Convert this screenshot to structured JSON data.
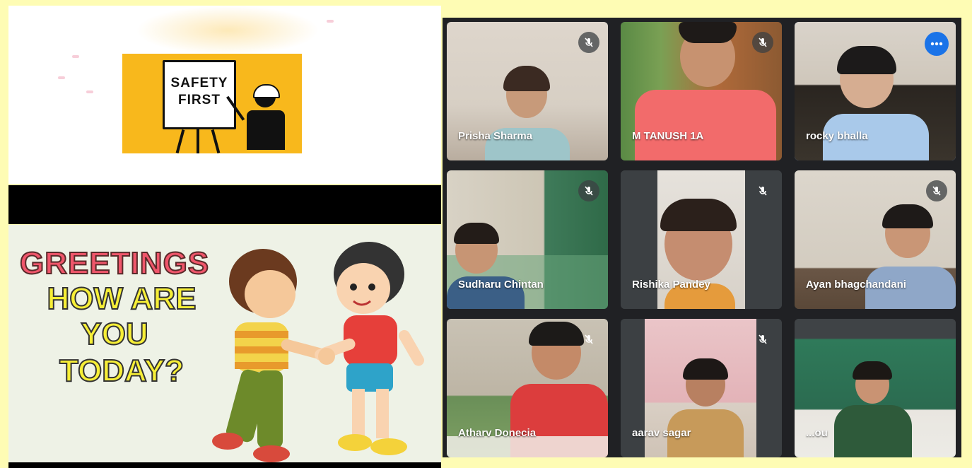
{
  "slides": {
    "safety_sign": {
      "line1": "SAFETY",
      "line2": "FIRST"
    },
    "greeting": {
      "line1": "GREETINGS",
      "line2": "HOW ARE",
      "line3": "YOU",
      "line4": "TODAY?"
    }
  },
  "meet": {
    "participants": [
      {
        "name": "Prisha Sharma",
        "muted": true
      },
      {
        "name": "M TANUSH 1A",
        "muted": true
      },
      {
        "name": "rocky bhalla",
        "muted": false,
        "active_speaker": true
      },
      {
        "name": "Sudharu Chintan",
        "muted": true
      },
      {
        "name": "Rishika Pandey",
        "muted": true
      },
      {
        "name": "Ayan bhagchandani",
        "muted": true
      },
      {
        "name": "Atharv Donecia",
        "muted": true
      },
      {
        "name": "aarav sagar",
        "muted": true
      },
      {
        "name": "...ou",
        "muted": false
      }
    ],
    "more_options_icon": "more-horiz-icon",
    "mute_icon": "mic-off-icon",
    "active_speaker_color": "#8ab4f8",
    "more_button_color": "#1a73e8"
  }
}
